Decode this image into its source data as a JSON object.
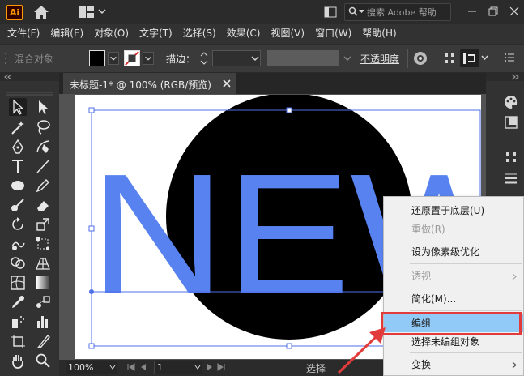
{
  "app": {
    "logo": "Ai",
    "search_placeholder": "搜索 Adobe 帮助"
  },
  "menubar": [
    "文件(F)",
    "编辑(E)",
    "对象(O)",
    "文字(T)",
    "选择(S)",
    "效果(C)",
    "视图(V)",
    "窗口(W)",
    "帮助(H)"
  ],
  "controlbar": {
    "selection_label": "混合对象",
    "stroke_label": "描边：",
    "opacity_label": "不透明度",
    "fill_color": "#000000"
  },
  "document": {
    "tab_title": "未标题-1* @ 100% (RGB/预览)",
    "text": "NEW",
    "text_color": "#5882f0",
    "circle_color": "#000000",
    "selection_color": "#4f6fe8"
  },
  "statusbar": {
    "zoom": "100%",
    "page": "1",
    "status": "选择"
  },
  "context_menu": {
    "items": [
      {
        "label": "还原置于底层(U)",
        "state": "normal"
      },
      {
        "label": "重做(R)",
        "state": "disabled"
      },
      {
        "separator": true
      },
      {
        "label": "设为像素级优化",
        "state": "normal"
      },
      {
        "separator": true
      },
      {
        "label": "透视",
        "state": "disabled",
        "submenu": true
      },
      {
        "separator": true
      },
      {
        "label": "简化(M)...",
        "state": "normal"
      },
      {
        "separator": true
      },
      {
        "label": "编组",
        "state": "selected"
      },
      {
        "label": "选择未编组对象",
        "state": "normal"
      },
      {
        "separator": true
      },
      {
        "label": "变换",
        "state": "normal",
        "submenu": true
      }
    ],
    "highlight_color": "#e23b3b"
  }
}
